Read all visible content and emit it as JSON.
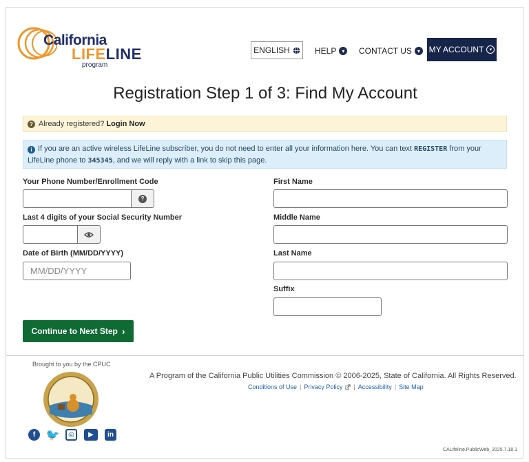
{
  "header": {
    "logo": {
      "word1": "California",
      "word2_a": "LIFE",
      "word2_b": "LINE",
      "word3": "program"
    },
    "lang_label": "ENGLISH",
    "help_label": "HELP",
    "contact_label": "CONTACT US",
    "account_label": "MY ACCOUNT"
  },
  "page_title": "Registration Step 1 of 3: Find My Account",
  "alerts": {
    "login_prompt": "Already registered?",
    "login_link": "Login Now",
    "text_part1": "If you are an active wireless LifeLine subscriber, you do not need to enter all your information here. You can text",
    "register_code": "REGISTER",
    "text_part2": "from your LifeLine phone to",
    "short_code": "345345",
    "text_part3": ", and we will reply with a link to skip this page."
  },
  "form": {
    "phone_label": "Your Phone Number/Enrollment Code",
    "ssn_label": "Last 4 digits of your Social Security Number",
    "dob_label": "Date of Birth (MM/DD/YYYY)",
    "dob_placeholder": "MM/DD/YYYY",
    "first_name_label": "First Name",
    "middle_name_label": "Middle Name",
    "last_name_label": "Last Name",
    "suffix_label": "Suffix",
    "continue_label": "Continue to Next Step"
  },
  "footer": {
    "brought_by": "Brought to you by the CPUC",
    "copyright": "A Program of the California Public Utilities Commission © 2006-2025, State of California. All Rights Reserved.",
    "links": [
      "Conditions of Use",
      "Privacy Policy",
      "Accessibility",
      "Site Map"
    ],
    "social_icons": [
      "facebook-icon",
      "twitter-icon",
      "instagram-icon",
      "youtube-icon",
      "linkedin-icon"
    ],
    "version": "CALifeline.PublicWeb_2025.7.18.1"
  },
  "colors": {
    "navy": "#16254a",
    "green": "#0f6a33",
    "orange": "#f0962a",
    "link": "#1f5fb0"
  }
}
